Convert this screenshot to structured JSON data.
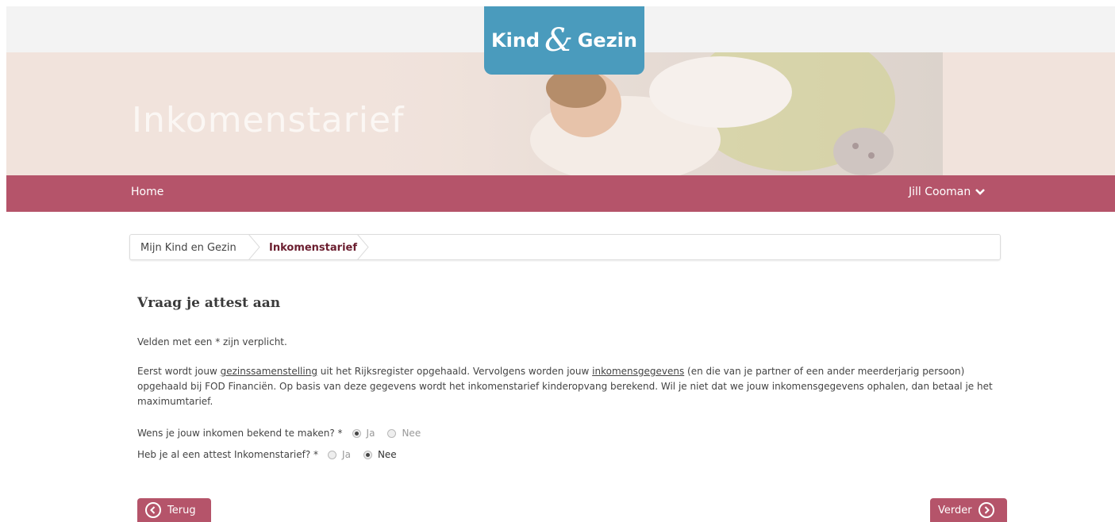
{
  "header": {
    "logo_left": "Kind",
    "logo_amp": "&",
    "logo_right": "Gezin",
    "banner_title": "Inkomenstarief"
  },
  "nav": {
    "home": "Home",
    "user": "Jill Cooman"
  },
  "breadcrumb": {
    "items": [
      "Mijn Kind en Gezin",
      "Inkomenstarief"
    ]
  },
  "main": {
    "title": "Vraag je attest aan",
    "required_note": "Velden met een * zijn verplicht.",
    "intro_1": "Eerst wordt jouw ",
    "intro_link1": "gezinssamenstelling",
    "intro_2": " uit het Rijksregister opgehaald. Vervolgens worden jouw ",
    "intro_link2": "inkomensgegevens",
    "intro_3": " (en die van je partner of een ander meerderjarig persoon) opgehaald bij FOD Financiën. Op basis van deze gegevens wordt het inkomenstarief kinderopvang berekend. Wil je niet dat we jouw inkomensgegevens ophalen, dan betaal je het maximumtarief.",
    "q1": {
      "label": "Wens je jouw inkomen bekend te maken? *",
      "opt_yes": "Ja",
      "opt_no": "Nee",
      "selected": "Ja"
    },
    "q2": {
      "label": "Heb je al een attest Inkomenstarief? *",
      "opt_yes": "Ja",
      "opt_no": "Nee",
      "selected": "Nee"
    }
  },
  "buttons": {
    "back": "Terug",
    "next": "Verder"
  },
  "colors": {
    "brand_rose": "#b5546a",
    "logo_blue": "#4a9bbd",
    "banner_bg": "#f1e3dc"
  }
}
